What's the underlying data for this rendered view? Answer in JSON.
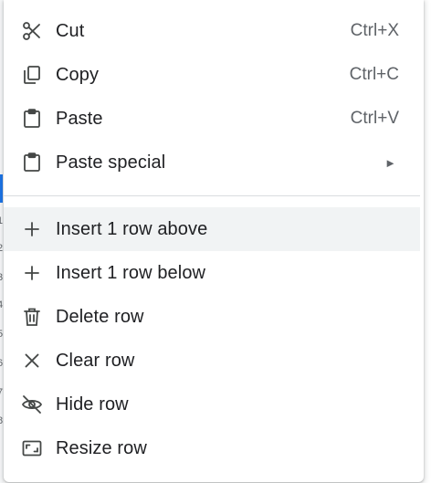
{
  "menu": {
    "clipboard_items": [
      {
        "label": "Cut",
        "shortcut": "Ctrl+X",
        "icon": "scissors-icon"
      },
      {
        "label": "Copy",
        "shortcut": "Ctrl+C",
        "icon": "copy-icon"
      },
      {
        "label": "Paste",
        "shortcut": "Ctrl+V",
        "icon": "paste-icon"
      },
      {
        "label": "Paste special",
        "submenu_arrow": "►",
        "icon": "paste-special-icon"
      }
    ],
    "row_items": [
      {
        "label": "Insert 1 row above",
        "icon": "plus-icon",
        "state": "hovered"
      },
      {
        "label": "Insert 1 row below",
        "icon": "plus-icon"
      },
      {
        "label": "Delete row",
        "icon": "trash-icon"
      },
      {
        "label": "Clear row",
        "icon": "close-icon"
      },
      {
        "label": "Hide row",
        "icon": "eye-off-icon"
      },
      {
        "label": "Resize row",
        "icon": "resize-icon"
      }
    ]
  },
  "background_row_numbers": [
    "1",
    "2",
    "3",
    "4",
    "5",
    "6",
    "7",
    "8"
  ],
  "colors": {
    "text": "#202124",
    "secondary_text": "#5f6368",
    "hover_background": "#f1f3f4",
    "divider": "#dadce0",
    "selection_accent": "#1a73e8"
  }
}
